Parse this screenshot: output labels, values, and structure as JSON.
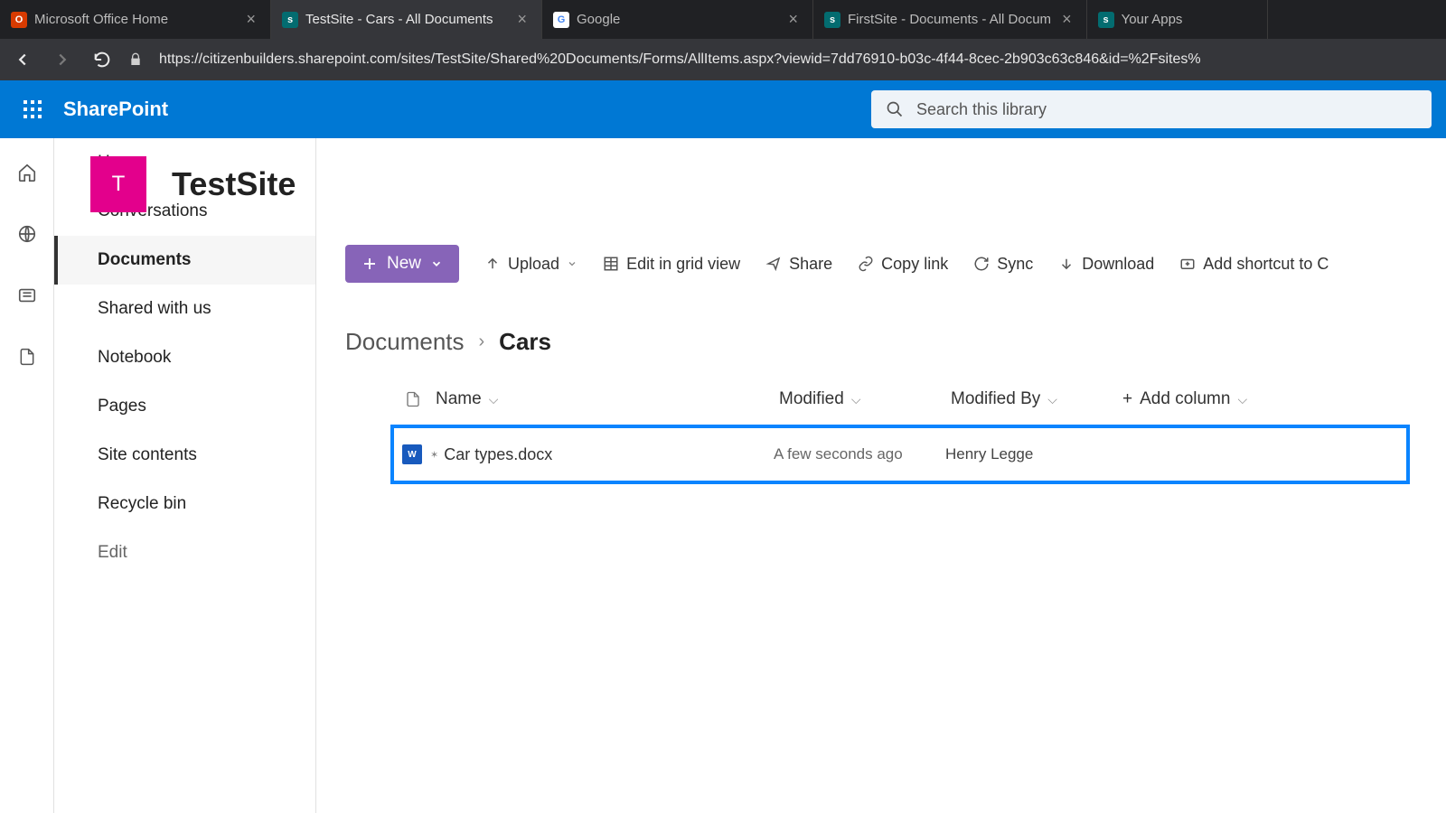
{
  "browser": {
    "tabs": [
      {
        "title": "Microsoft Office Home",
        "active": false
      },
      {
        "title": "TestSite - Cars - All Documents",
        "active": true
      },
      {
        "title": "Google",
        "active": false
      },
      {
        "title": "FirstSite - Documents - All Docum",
        "active": false
      },
      {
        "title": "Your Apps",
        "active": false
      }
    ],
    "url": "https://citizenbuilders.sharepoint.com/sites/TestSite/Shared%20Documents/Forms/AllItems.aspx?viewid=7dd76910-b03c-4f44-8cec-2b903c63c846&id=%2Fsites%"
  },
  "suite": {
    "product": "SharePoint",
    "search_placeholder": "Search this library"
  },
  "site": {
    "logo_letter": "T",
    "title": "TestSite"
  },
  "nav": {
    "items": [
      "Home",
      "Conversations",
      "Documents",
      "Shared with us",
      "Notebook",
      "Pages",
      "Site contents",
      "Recycle bin"
    ],
    "edit": "Edit",
    "selected_index": 2
  },
  "commands": {
    "new": "New",
    "upload": "Upload",
    "grid": "Edit in grid view",
    "share": "Share",
    "copylink": "Copy link",
    "sync": "Sync",
    "download": "Download",
    "shortcut": "Add shortcut to C"
  },
  "breadcrumb": {
    "root": "Documents",
    "current": "Cars"
  },
  "columns": {
    "name": "Name",
    "modified": "Modified",
    "modifiedby": "Modified By",
    "add": "Add column"
  },
  "files": [
    {
      "name": "Car types.docx",
      "modified": "A few seconds ago",
      "modified_by": "Henry Legge"
    }
  ]
}
